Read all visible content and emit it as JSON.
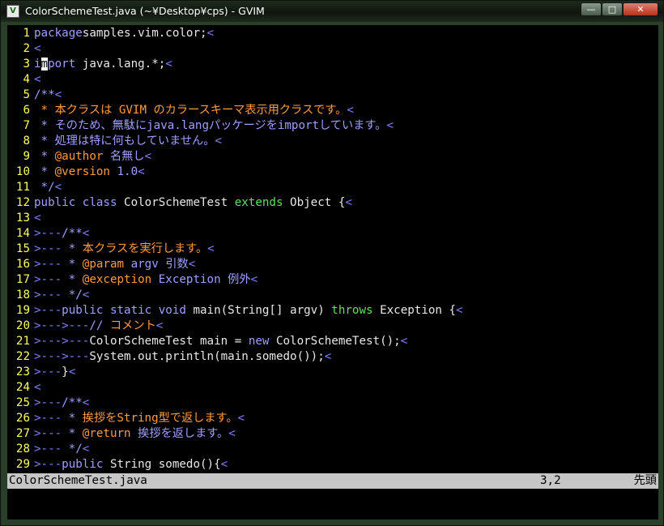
{
  "window": {
    "title": "ColorSchemeTest.java (~¥Desktop¥cps) - GVIM",
    "buttons": {
      "minimize": "—",
      "maximize": "□",
      "close": "✕"
    },
    "icon": "gvim-icon"
  },
  "editor": {
    "lines": [
      {
        "n": "1",
        "segs": [
          [
            "kw",
            "package"
          ],
          [
            "",
            "samples.vim.color;"
          ],
          [
            "nt",
            "<"
          ]
        ]
      },
      {
        "n": "2",
        "segs": [
          [
            "nt",
            "<"
          ]
        ]
      },
      {
        "n": "3",
        "segs": [
          [
            "kw",
            "i"
          ],
          [
            "cursor",
            "m"
          ],
          [
            "kw",
            "port"
          ],
          [
            "",
            " java.lang.*;"
          ],
          [
            "nt",
            "<"
          ]
        ]
      },
      {
        "n": "4",
        "segs": [
          [
            "nt",
            "<"
          ]
        ]
      },
      {
        "n": "5",
        "segs": [
          [
            "kw",
            "/**"
          ],
          [
            "nt",
            "<"
          ]
        ]
      },
      {
        "n": "6",
        "segs": [
          [
            "cm",
            " * 本クラスは GVIM のカラースキーマ表示用クラスです。"
          ],
          [
            "nt",
            "<"
          ]
        ]
      },
      {
        "n": "7",
        "segs": [
          [
            "kw",
            " * そのため、無駄にjava.langパッケージをimportしています。"
          ],
          [
            "nt",
            "<"
          ]
        ]
      },
      {
        "n": "8",
        "segs": [
          [
            "kw",
            " * 処理は特に何もしていません。"
          ],
          [
            "nt",
            "<"
          ]
        ]
      },
      {
        "n": "9",
        "segs": [
          [
            "kw",
            " * "
          ],
          [
            "cm",
            "@author"
          ],
          [
            "kw",
            " 名無し"
          ],
          [
            "nt",
            "<"
          ]
        ]
      },
      {
        "n": "10",
        "segs": [
          [
            "kw",
            " * "
          ],
          [
            "cm",
            "@version"
          ],
          [
            "kw",
            " 1.0"
          ],
          [
            "nt",
            "<"
          ]
        ]
      },
      {
        "n": "11",
        "segs": [
          [
            "kw",
            " */"
          ],
          [
            "nt",
            "<"
          ]
        ]
      },
      {
        "n": "12",
        "segs": [
          [
            "kw",
            "public class"
          ],
          [
            "",
            " ColorSchemeTest "
          ],
          [
            "ty",
            "extends"
          ],
          [
            "",
            " Object {"
          ],
          [
            "nt",
            "<"
          ]
        ]
      },
      {
        "n": "13",
        "segs": [
          [
            "nt",
            "<"
          ]
        ]
      },
      {
        "n": "14",
        "segs": [
          [
            "nt",
            ">---"
          ],
          [
            "kw",
            "/**"
          ],
          [
            "nt",
            "<"
          ]
        ]
      },
      {
        "n": "15",
        "segs": [
          [
            "nt",
            ">---"
          ],
          [
            "kw",
            " * "
          ],
          [
            "cm",
            "本クラスを実行します。"
          ],
          [
            "nt",
            "<"
          ]
        ]
      },
      {
        "n": "16",
        "segs": [
          [
            "nt",
            ">---"
          ],
          [
            "kw",
            " * "
          ],
          [
            "cm",
            "@param"
          ],
          [
            "kw",
            " argv 引数"
          ],
          [
            "nt",
            "<"
          ]
        ]
      },
      {
        "n": "17",
        "segs": [
          [
            "nt",
            ">---"
          ],
          [
            "kw",
            " * "
          ],
          [
            "cm",
            "@exception"
          ],
          [
            "kw",
            " Exception 例外"
          ],
          [
            "nt",
            "<"
          ]
        ]
      },
      {
        "n": "18",
        "segs": [
          [
            "nt",
            ">---"
          ],
          [
            "kw",
            " */"
          ],
          [
            "nt",
            "<"
          ]
        ]
      },
      {
        "n": "19",
        "segs": [
          [
            "nt",
            ">---"
          ],
          [
            "kw",
            "public static void"
          ],
          [
            "",
            " main(String[] argv) "
          ],
          [
            "ty",
            "throws"
          ],
          [
            "",
            " Exception {"
          ],
          [
            "nt",
            "<"
          ]
        ]
      },
      {
        "n": "20",
        "segs": [
          [
            "nt",
            ">--->---"
          ],
          [
            "kw",
            "// "
          ],
          [
            "cm",
            "コメント"
          ],
          [
            "nt",
            "<"
          ]
        ]
      },
      {
        "n": "21",
        "segs": [
          [
            "nt",
            ">--->---"
          ],
          [
            "",
            "ColorSchemeTest main = "
          ],
          [
            "kw",
            "new"
          ],
          [
            "",
            " ColorSchemeTest();"
          ],
          [
            "nt",
            "<"
          ]
        ]
      },
      {
        "n": "22",
        "segs": [
          [
            "nt",
            ">--->---"
          ],
          [
            "",
            "System.out.println(main.somedo());"
          ],
          [
            "nt",
            "<"
          ]
        ]
      },
      {
        "n": "23",
        "segs": [
          [
            "nt",
            ">---"
          ],
          [
            "",
            "}"
          ],
          [
            "nt",
            "<"
          ]
        ]
      },
      {
        "n": "24",
        "segs": [
          [
            "nt",
            "<"
          ]
        ]
      },
      {
        "n": "25",
        "segs": [
          [
            "nt",
            ">---"
          ],
          [
            "kw",
            "/**"
          ],
          [
            "nt",
            "<"
          ]
        ]
      },
      {
        "n": "26",
        "segs": [
          [
            "nt",
            ">---"
          ],
          [
            "kw",
            " * "
          ],
          [
            "cm",
            "挨拶をString型で返します。"
          ],
          [
            "nt",
            "<"
          ]
        ]
      },
      {
        "n": "27",
        "segs": [
          [
            "nt",
            ">---"
          ],
          [
            "kw",
            " * "
          ],
          [
            "cm",
            "@return"
          ],
          [
            "kw",
            " 挨拶を返します。"
          ],
          [
            "nt",
            "<"
          ]
        ]
      },
      {
        "n": "28",
        "segs": [
          [
            "nt",
            ">---"
          ],
          [
            "kw",
            " */"
          ],
          [
            "nt",
            "<"
          ]
        ]
      },
      {
        "n": "29",
        "segs": [
          [
            "nt",
            ">---"
          ],
          [
            "kw",
            "public"
          ],
          [
            "",
            " String somedo(){"
          ],
          [
            "nt",
            "<"
          ]
        ]
      }
    ]
  },
  "statusline": {
    "filename": "ColorSchemeTest.java",
    "position": "3,2",
    "scroll": "先頭"
  },
  "colors": {
    "line_number": "#ffff60",
    "nontext": "#7f7fff",
    "keyword": "#9f9fff",
    "comment": "#ff9c3d",
    "type": "#60e060",
    "status_bg": "#c6c6c6"
  }
}
